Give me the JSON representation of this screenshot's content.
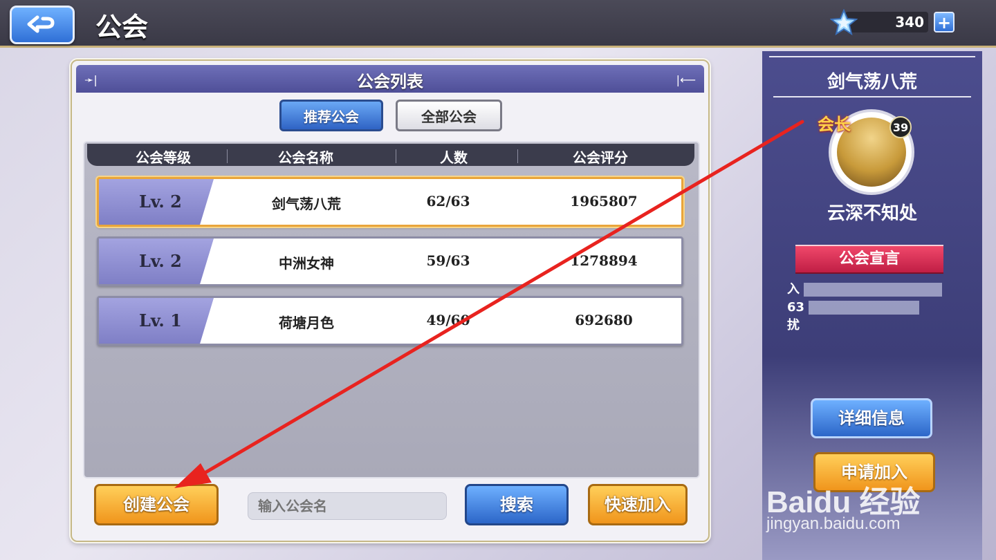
{
  "header": {
    "title": "公会",
    "currency_value": "340",
    "plus_label": "+"
  },
  "panel": {
    "title": "公会列表",
    "tabs": [
      {
        "label": "推荐公会",
        "active": true
      },
      {
        "label": "全部公会",
        "active": false
      }
    ],
    "columns": [
      "公会等级",
      "公会名称",
      "人数",
      "公会评分"
    ],
    "rows": [
      {
        "level": "Lv. 2",
        "name": "剑气荡八荒",
        "members": "62/63",
        "score": "1965807",
        "selected": true
      },
      {
        "level": "Lv. 2",
        "name": "中洲女神",
        "members": "59/63",
        "score": "1278894",
        "selected": false
      },
      {
        "level": "Lv. 1",
        "name": "荷塘月色",
        "members": "49/60",
        "score": "692680",
        "selected": false
      }
    ],
    "create_label": "创建公会",
    "search_placeholder": "输入公会名",
    "search_label": "搜索",
    "quick_join_label": "快速加入"
  },
  "side": {
    "guild_name": "剑气荡八荒",
    "leader_tag": "会长",
    "leader_level": "39",
    "leader_name": "云深不知处",
    "declaration_title": "公会宣言",
    "declaration_lines": [
      "入",
      "63",
      "扰"
    ],
    "detail_label": "详细信息",
    "apply_label": "申请加入"
  },
  "watermark": {
    "brand": "Baidu 经验",
    "url": "jingyan.baidu.com"
  },
  "colors": {
    "topbar": "#3a3946",
    "panel_header": "#4f4f98",
    "gold_button": "#f0951c",
    "blue_button": "#2c66c8",
    "annotation_arrow": "#e8231f"
  }
}
